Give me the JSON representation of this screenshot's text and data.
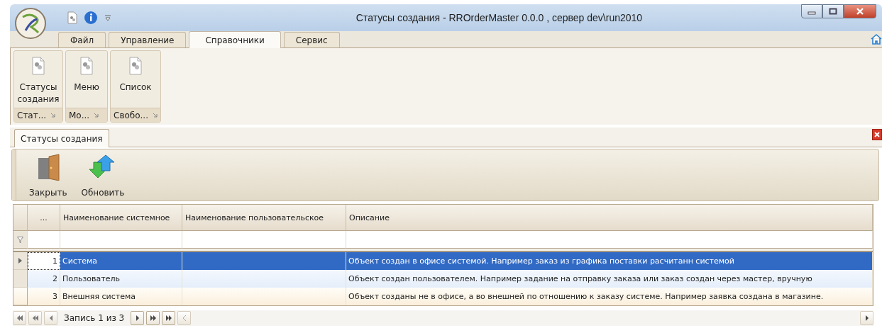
{
  "window": {
    "title": "Статусы создания - RROrderMaster 0.0.0 , сервер dev\\run2010"
  },
  "ribbon": {
    "tabs": [
      {
        "label": "Файл",
        "selected": false
      },
      {
        "label": "Управление",
        "selected": false
      },
      {
        "label": "Справочники",
        "selected": true
      },
      {
        "label": "Сервис",
        "selected": false
      }
    ],
    "groups": [
      {
        "label": "Статусы создания",
        "caption": "Стат..."
      },
      {
        "label": "Меню",
        "caption": "Мо..."
      },
      {
        "label": "Список",
        "caption": "Свобо..."
      }
    ]
  },
  "document_tabs": [
    {
      "label": "Статусы создания",
      "selected": true
    }
  ],
  "toolbar": [
    {
      "label": "Закрыть",
      "kind": "close"
    },
    {
      "label": "Обновить",
      "kind": "refresh"
    }
  ],
  "table": {
    "columns": [
      "...",
      "Наименование системное",
      "Наименование пользовательское",
      "Описание"
    ],
    "rows": [
      {
        "number": "1",
        "system_name": "Система",
        "description": "Объект создан в офисе системой. Например заказ из графика поставки расчитанн системой",
        "selected": true
      },
      {
        "number": "2",
        "system_name": "Пользователь",
        "description": "Объект создан пользователем. Например задание на отправку заказа или заказ создан через мастер, вручную",
        "selected": false
      },
      {
        "number": "3",
        "system_name": "Внешняя система",
        "description": "Объект созданы не в офисе, а во внешней по отношению к заказу системе. Например заявка создана в магазине.",
        "selected": false
      }
    ]
  },
  "navigator": {
    "record_text": "Запись 1 из 3"
  }
}
